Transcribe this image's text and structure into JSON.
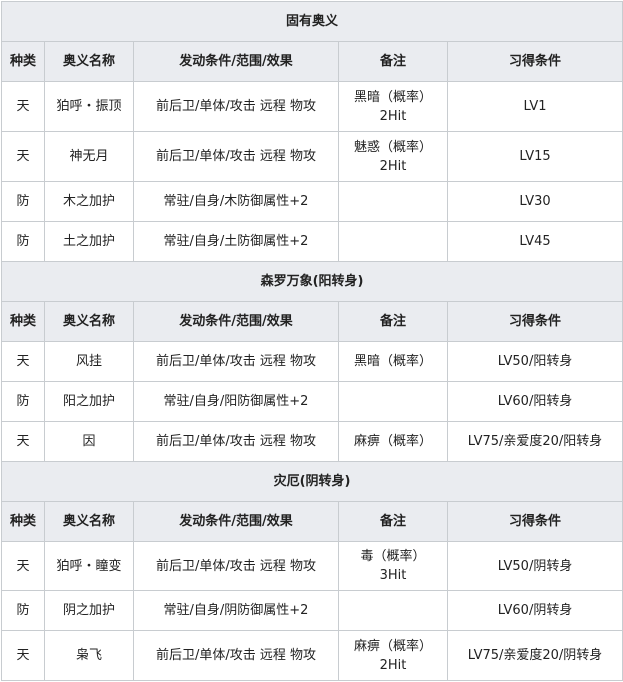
{
  "columns": [
    "种类",
    "奥义名称",
    "发动条件/范围/效果",
    "备注",
    "习得条件"
  ],
  "sections": [
    {
      "title": "固有奥义",
      "rows": [
        {
          "type": "天",
          "name": "狛呼・振顶",
          "effect": "前后卫/单体/攻击 远程 物攻",
          "note1": "黑暗（概率）",
          "note2": "2Hit",
          "cond": "LV1"
        },
        {
          "type": "天",
          "name": "神无月",
          "effect": "前后卫/单体/攻击 远程 物攻",
          "note1": "魅惑（概率）",
          "note2": "2Hit",
          "cond": "LV15"
        },
        {
          "type": "防",
          "name": "木之加护",
          "effect": "常驻/自身/木防御属性+2",
          "note1": "",
          "note2": "",
          "cond": "LV30"
        },
        {
          "type": "防",
          "name": "土之加护",
          "effect": "常驻/自身/土防御属性+2",
          "note1": "",
          "note2": "",
          "cond": "LV45"
        }
      ]
    },
    {
      "title": "森罗万象(阳转身)",
      "rows": [
        {
          "type": "天",
          "name": "风挂",
          "effect": "前后卫/单体/攻击 远程 物攻",
          "note1": "黑暗（概率）",
          "note2": "",
          "cond": "LV50/阳转身"
        },
        {
          "type": "防",
          "name": "阳之加护",
          "effect": "常驻/自身/阳防御属性+2",
          "note1": "",
          "note2": "",
          "cond": "LV60/阳转身"
        },
        {
          "type": "天",
          "name": "因",
          "effect": "前后卫/单体/攻击 远程 物攻",
          "note1": "麻痹（概率）",
          "note2": "",
          "cond": "LV75/亲爱度20/阳转身"
        }
      ]
    },
    {
      "title": "灾厄(阴转身)",
      "rows": [
        {
          "type": "天",
          "name": "狛呼・瞳变",
          "effect": "前后卫/单体/攻击 远程 物攻",
          "note1": "毒（概率）",
          "note2": "3Hit",
          "cond": "LV50/阴转身"
        },
        {
          "type": "防",
          "name": "阴之加护",
          "effect": "常驻/自身/阴防御属性+2",
          "note1": "",
          "note2": "",
          "cond": "LV60/阴转身"
        },
        {
          "type": "天",
          "name": "枭飞",
          "effect": "前后卫/单体/攻击 远程 物攻",
          "note1": "麻痹（概率）",
          "note2": "2Hit",
          "cond": "LV75/亲爱度20/阴转身"
        }
      ]
    }
  ]
}
